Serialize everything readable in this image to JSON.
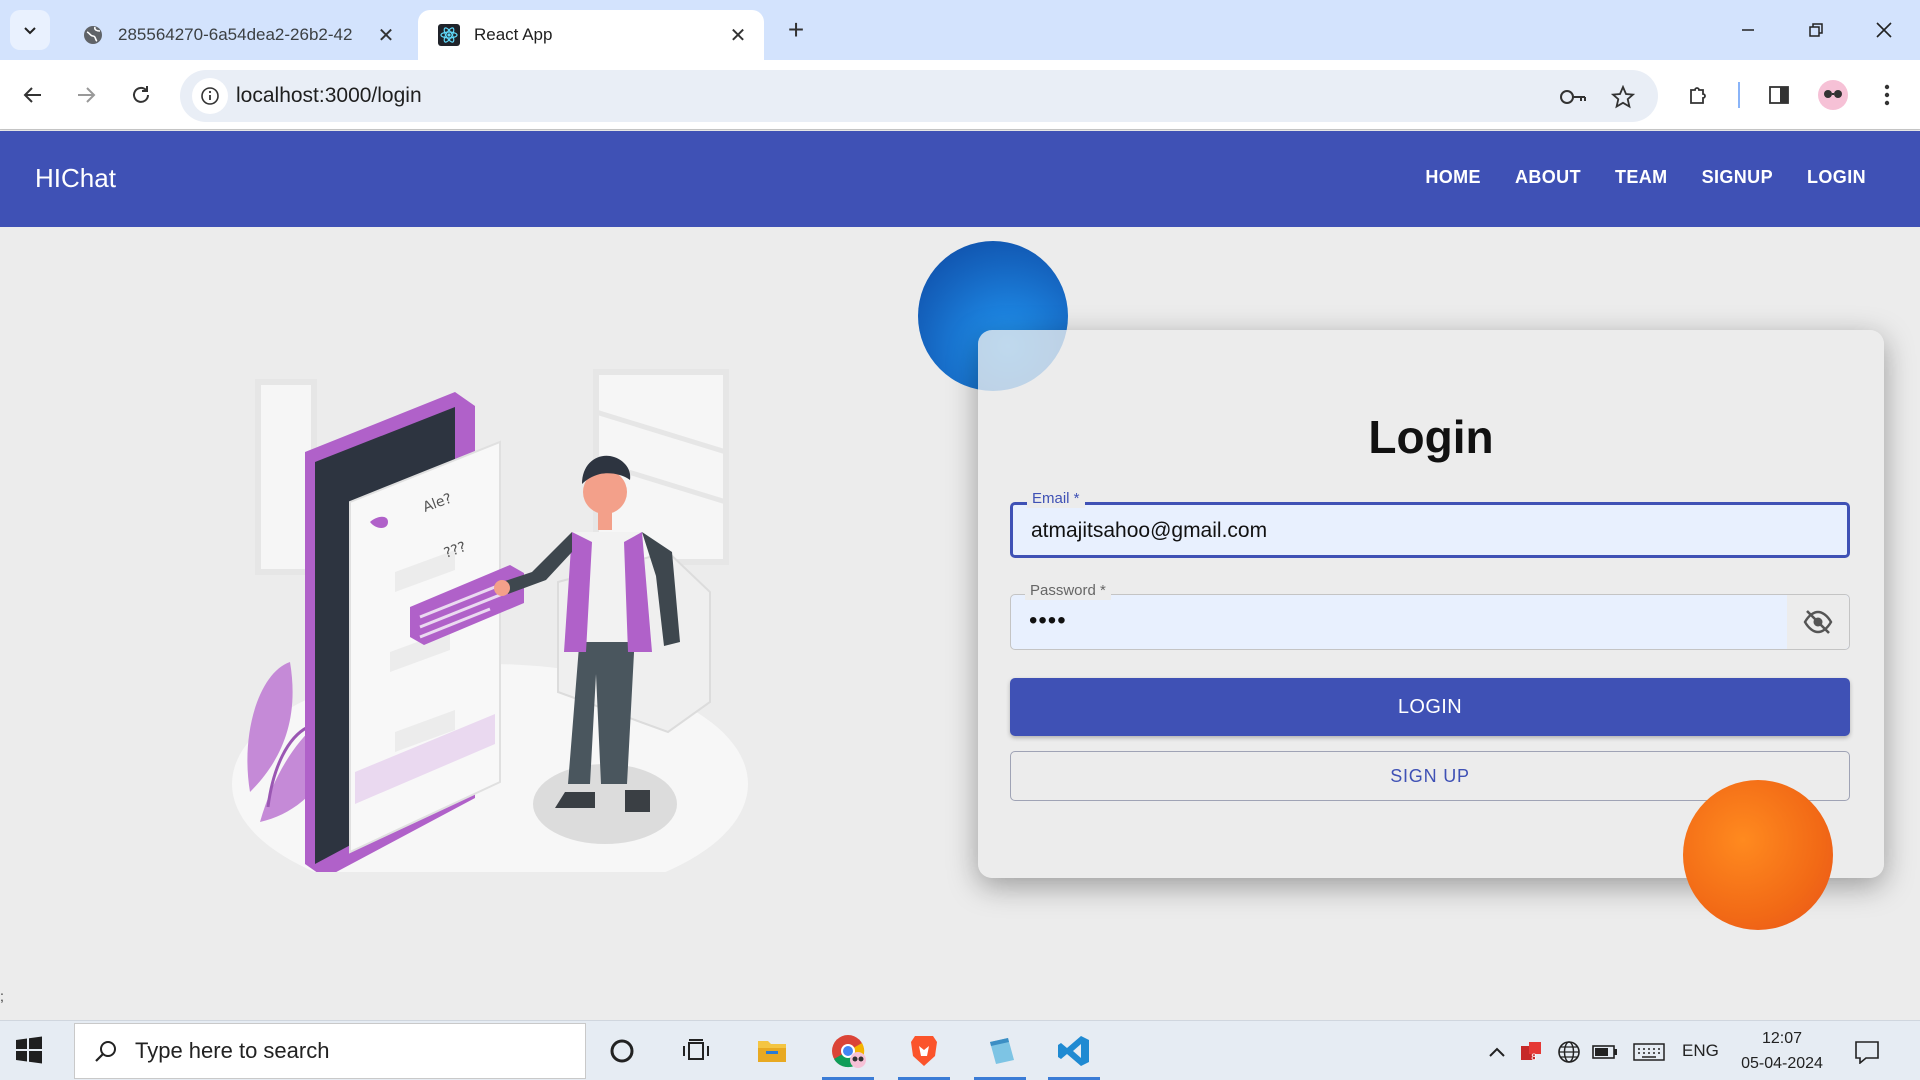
{
  "browser": {
    "tabs": [
      {
        "title": "285564270-6a54dea2-26b2-42",
        "active": false
      },
      {
        "title": "React App",
        "active": true
      }
    ],
    "url": "localhost:3000/login"
  },
  "app": {
    "brand": "HIChat",
    "nav": [
      "HOME",
      "ABOUT",
      "TEAM",
      "SIGNUP",
      "LOGIN"
    ]
  },
  "login": {
    "title": "Login",
    "email_label": "Email *",
    "email_value": "atmajitsahoo@gmail.com",
    "password_label": "Password *",
    "password_value": "••••",
    "login_button": "LOGIN",
    "signup_button": "SIGN UP"
  },
  "page": {
    "stray_text": ";"
  },
  "taskbar": {
    "search_placeholder": "Type here to search",
    "language": "ENG",
    "time": "12:07",
    "date": "05-04-2024"
  },
  "colors": {
    "primary": "#3f51b5",
    "blob_blue": "#1565c0",
    "blob_orange": "#f26a16",
    "tab_strip": "#d3e3fd"
  }
}
